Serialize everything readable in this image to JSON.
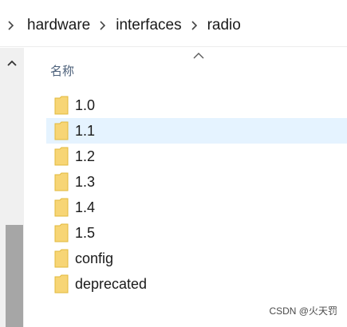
{
  "breadcrumb": {
    "items": [
      "hardware",
      "interfaces",
      "radio"
    ]
  },
  "file_list": {
    "column_header": "名称",
    "rows": [
      {
        "name": "1.0",
        "selected": false
      },
      {
        "name": "1.1",
        "selected": true
      },
      {
        "name": "1.2",
        "selected": false
      },
      {
        "name": "1.3",
        "selected": false
      },
      {
        "name": "1.4",
        "selected": false
      },
      {
        "name": "1.5",
        "selected": false
      },
      {
        "name": "config",
        "selected": false
      },
      {
        "name": "deprecated",
        "selected": false
      }
    ]
  },
  "watermark": "CSDN @火天罚",
  "icons": {
    "breadcrumb_separator": "chevron-right-icon",
    "scroll_up": "chevron-up-icon",
    "sort": "sort-ascending-icon",
    "folder": "folder-icon"
  },
  "colors": {
    "folder_fill": "#f7d575",
    "folder_edge": "#e2b93b",
    "selection": "#e5f3ff",
    "header_text": "#4c607a"
  }
}
